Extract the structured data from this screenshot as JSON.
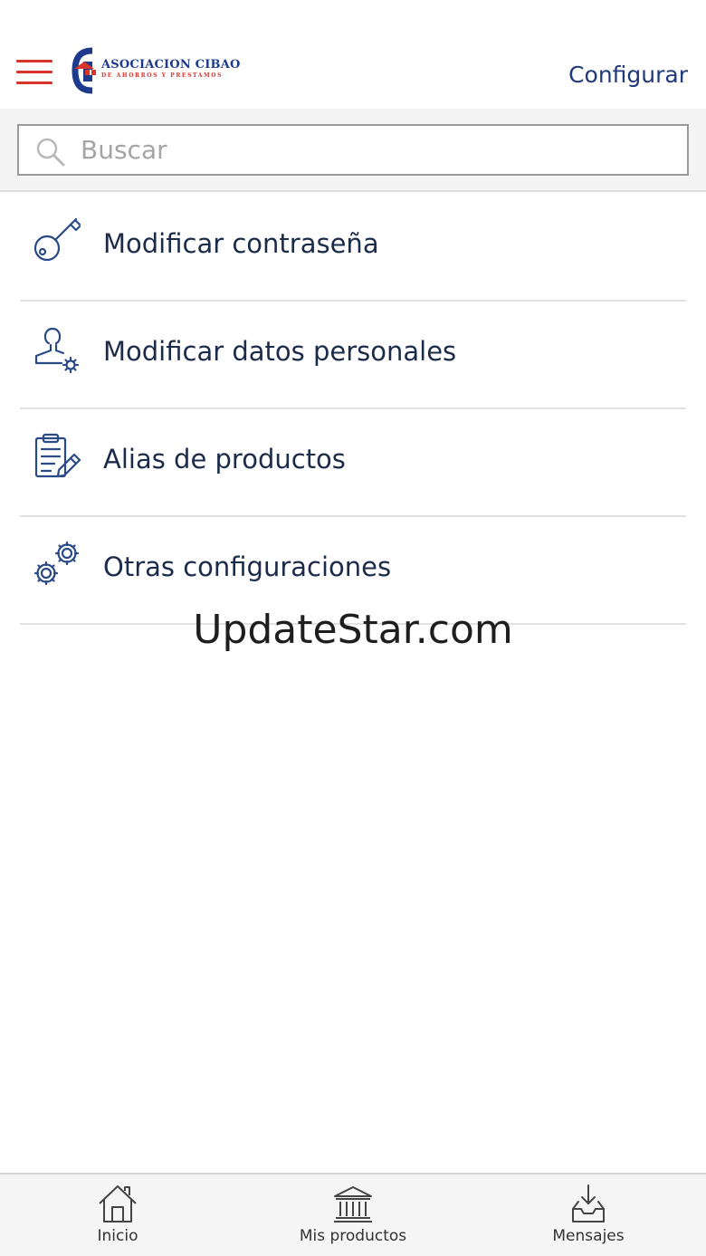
{
  "header": {
    "logo": {
      "name": "ASOCIACION CIBAO",
      "subtitle": "DE AHORROS Y PRESTAMOS"
    },
    "menu_icon": "hamburger-icon",
    "config_label": "Configurar"
  },
  "search": {
    "placeholder": "Buscar",
    "value": ""
  },
  "menu": {
    "items": [
      {
        "label": "Modificar contraseña",
        "icon": "key-icon"
      },
      {
        "label": "Modificar datos personales",
        "icon": "user-settings-icon"
      },
      {
        "label": "Alias de productos",
        "icon": "clipboard-edit-icon"
      },
      {
        "label": "Otras configuraciones",
        "icon": "gears-icon"
      }
    ]
  },
  "watermark": "UpdateStar.com",
  "tabbar": {
    "tabs": [
      {
        "label": "Inicio",
        "icon": "home-icon"
      },
      {
        "label": "Mis productos",
        "icon": "bank-icon"
      },
      {
        "label": "Mensajes",
        "icon": "inbox-download-icon"
      }
    ]
  },
  "colors": {
    "accent_red": "#d9342b",
    "brand_blue": "#1e3a8c",
    "text": "#1b2b4a",
    "icon_stroke": "#2a4a86"
  }
}
